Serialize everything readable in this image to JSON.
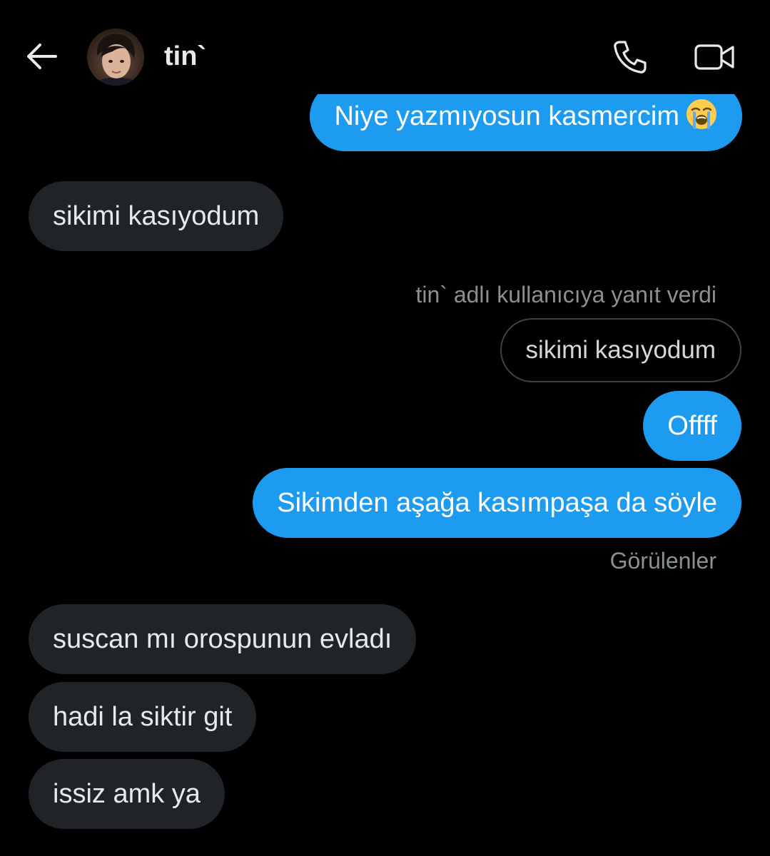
{
  "header": {
    "contact_name": "tin`",
    "back_icon": "arrow-left-icon",
    "call_icon": "phone-icon",
    "video_icon": "video-camera-icon"
  },
  "messages": [
    {
      "direction": "sent",
      "text": "Niye yazmıyosun kasmercim",
      "emoji": "loudly-crying-face"
    },
    {
      "direction": "received",
      "text": "sikimi kasıyodum"
    },
    {
      "direction": "sent",
      "reply_label": "tin` adlı kullanıcıya yanıt verdi",
      "quoted_text": "sikimi kasıyodum",
      "text": "Offff"
    },
    {
      "direction": "sent",
      "text": "Sikimden aşağa kasımpaşa da söyle"
    },
    {
      "direction": "received",
      "text": "suscan mı orospunun evladı"
    },
    {
      "direction": "received",
      "text": "hadi la siktir git"
    },
    {
      "direction": "received",
      "text": "issiz amk ya"
    }
  ],
  "seen_label": "Görülenler",
  "colors": {
    "background": "#000000",
    "sent_bubble": "#1d9bf0",
    "received_bubble": "#202327",
    "meta_text": "#8b9095"
  }
}
